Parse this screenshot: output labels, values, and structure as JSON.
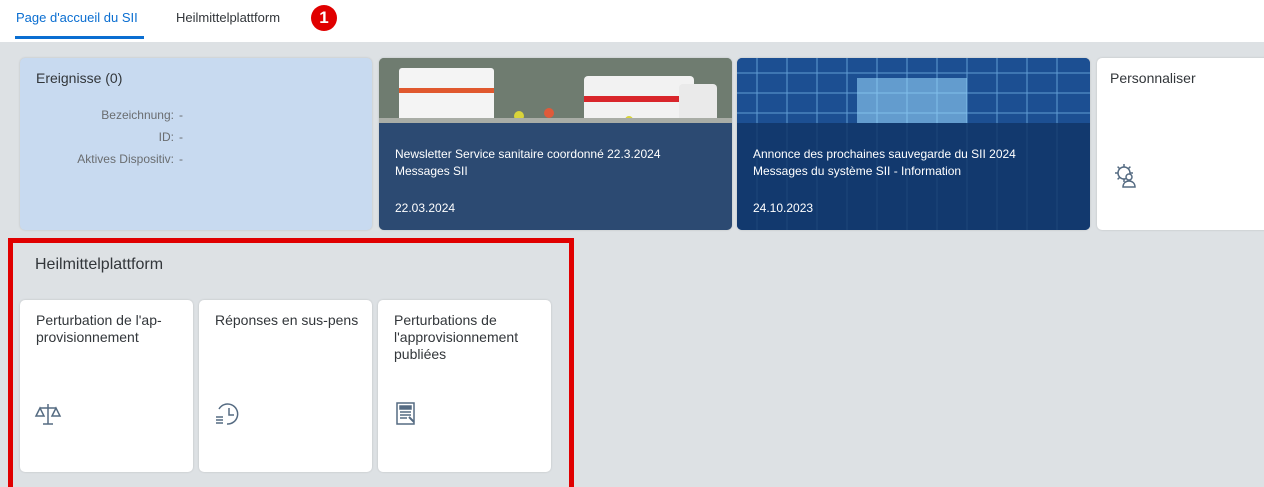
{
  "tabs": [
    {
      "label": "Page d'accueil du SII",
      "active": true
    },
    {
      "label": "Heilmittelplattform",
      "active": false
    }
  ],
  "annotation_badge": "1",
  "events_tile": {
    "title": "Ereignisse (0)",
    "fields": [
      {
        "label": "Bezeichnung:",
        "value": "-"
      },
      {
        "label": "ID:",
        "value": "-"
      },
      {
        "label": "Aktives Dispositiv:",
        "value": "-"
      }
    ]
  },
  "news_tiles": [
    {
      "headline": "Newsletter Service sanitaire coordonné 22.3.2024",
      "subtitle": "Messages SII",
      "date": "22.03.2024"
    },
    {
      "headline": "Annonce des prochaines sauvegarde du SII 2024",
      "subtitle": "Messages du système SII - Information",
      "date": "24.10.2023"
    }
  ],
  "personalize_tile": {
    "title": "Personnaliser",
    "icon": "user-settings-icon"
  },
  "group": {
    "title": "Heilmittelplattform",
    "apps": [
      {
        "title": "Perturbation de l'ap-provisionnement",
        "icon": "balance-scale-icon"
      },
      {
        "title": "Réponses en sus-pens",
        "icon": "pending-history-icon"
      },
      {
        "title": "Perturbations de l'approvisionnement publiées",
        "icon": "document-list-icon"
      }
    ]
  },
  "colors": {
    "accent": "#0a6ed1",
    "annotation": "#e00000",
    "background": "#dde1e4"
  }
}
